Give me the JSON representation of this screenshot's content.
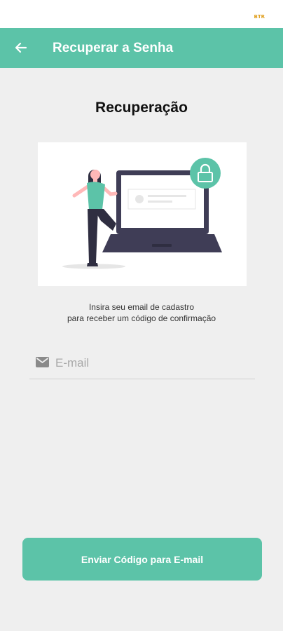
{
  "status_bar": {
    "indicator_text": "BTR"
  },
  "app_bar": {
    "title": "Recuperar a Senha",
    "back_icon": "arrow-left-icon"
  },
  "main": {
    "heading": "Recuperação",
    "instruction_line1": "Insira seu email de cadastro",
    "instruction_line2": "para receber um código de confirmação"
  },
  "email_field": {
    "placeholder": "E-mail",
    "value": "",
    "icon": "mail-icon"
  },
  "send_button": {
    "label": "Enviar Código para E-mail"
  },
  "colors": {
    "accent": "#5cc3a8",
    "background": "#efefef",
    "laptop": "#3f3d56"
  }
}
